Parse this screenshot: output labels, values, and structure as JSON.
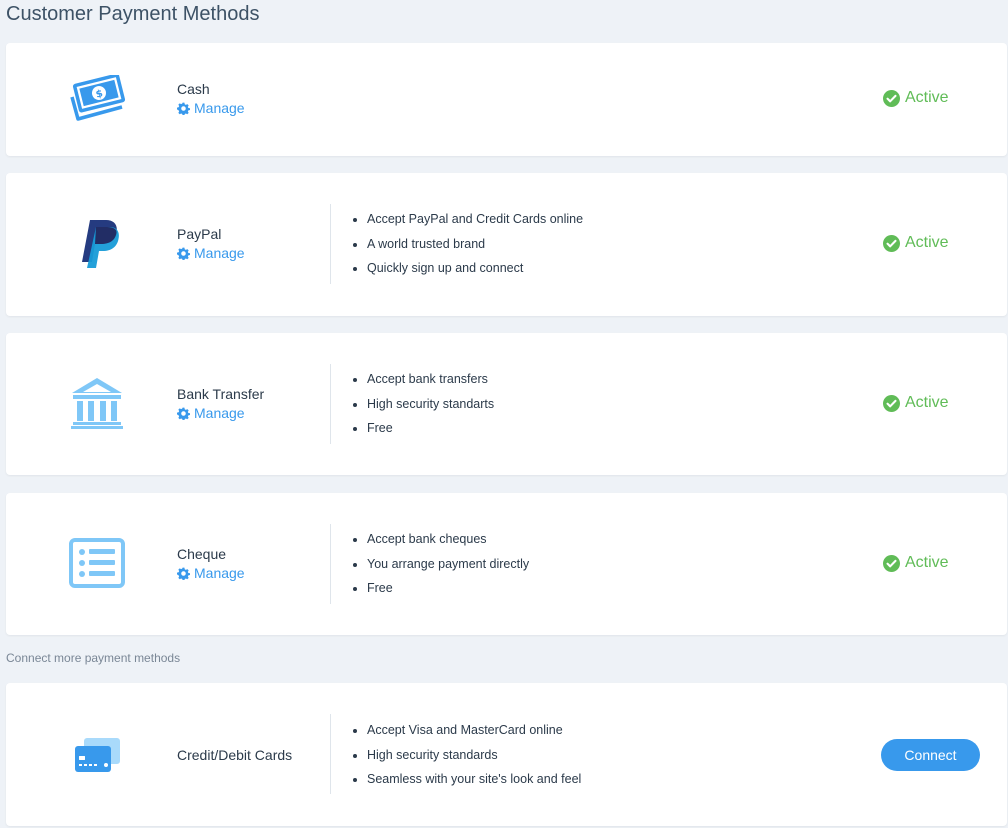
{
  "page": {
    "title": "Customer Payment Methods"
  },
  "colors": {
    "accent": "#3899ec",
    "active": "#60bc57",
    "icon": "#7fc7f7"
  },
  "methods": [
    {
      "name": "Cash",
      "manage": "Manage",
      "status": "Active",
      "icon": "cash-icon",
      "features": []
    },
    {
      "name": "PayPal",
      "manage": "Manage",
      "status": "Active",
      "icon": "paypal-icon",
      "features": [
        "Accept PayPal and Credit Cards online",
        "A world trusted brand",
        "Quickly sign up and connect"
      ]
    },
    {
      "name": "Bank Transfer",
      "manage": "Manage",
      "status": "Active",
      "icon": "bank-icon",
      "features": [
        "Accept bank transfers",
        "High security standarts",
        "Free"
      ]
    },
    {
      "name": "Cheque",
      "manage": "Manage",
      "status": "Active",
      "icon": "cheque-icon",
      "features": [
        "Accept bank cheques",
        "You arrange payment directly",
        "Free"
      ]
    }
  ],
  "more": {
    "label": "Connect more payment methods",
    "methods": [
      {
        "name": "Credit/Debit Cards",
        "action": "Connect",
        "icon": "credit-card-icon",
        "features": [
          "Accept Visa and MasterCard online",
          "High security standards",
          "Seamless with your site's look and feel"
        ]
      }
    ]
  }
}
